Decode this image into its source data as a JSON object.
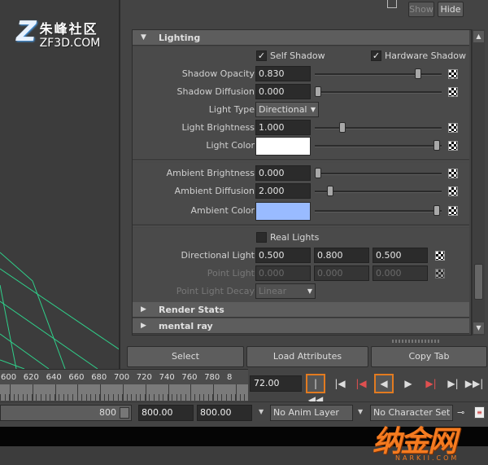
{
  "watermark_top": {
    "logo_letter": "Z",
    "chinese": "朱峰社区",
    "site": "ZF3D.COM"
  },
  "watermark_bottom": {
    "chinese": "纳金网",
    "site": "NARKII.COM"
  },
  "topbar": {
    "show_label": "Show",
    "hide_label": "Hide"
  },
  "sections": {
    "lighting": {
      "title": "Lighting",
      "self_shadow_label": "Self Shadow",
      "self_shadow_checked": true,
      "hardware_shadow_label": "Hardware Shadow",
      "hardware_shadow_checked": true,
      "shadow_opacity": {
        "label": "Shadow Opacity",
        "value": "0.830",
        "fraction": 0.83
      },
      "shadow_diffusion": {
        "label": "Shadow Diffusion",
        "value": "0.000",
        "fraction": 0.0
      },
      "light_type": {
        "label": "Light Type",
        "value": "Directional"
      },
      "light_brightness": {
        "label": "Light Brightness",
        "value": "1.000",
        "fraction": 0.2
      },
      "light_color": {
        "label": "Light Color",
        "color": "#ffffff"
      },
      "ambient_brightness": {
        "label": "Ambient Brightness",
        "value": "0.000",
        "fraction": 0.0
      },
      "ambient_diffusion": {
        "label": "Ambient Diffusion",
        "value": "2.000",
        "fraction": 0.1
      },
      "ambient_color": {
        "label": "Ambient Color",
        "color": "#99bbff"
      },
      "real_lights": {
        "label": "Real Lights",
        "checked": false
      },
      "directional_light": {
        "label": "Directional Light",
        "values": [
          "0.500",
          "0.800",
          "0.500"
        ]
      },
      "point_light": {
        "label": "Point Light",
        "values": [
          "0.000",
          "0.000",
          "0.000"
        ]
      },
      "point_light_decay": {
        "label": "Point Light Decay",
        "value": "Linear"
      }
    },
    "render_stats": {
      "title": "Render Stats"
    },
    "mental_ray": {
      "title": "mental ray"
    }
  },
  "buttons": {
    "select": "Select",
    "load_attributes": "Load Attributes",
    "copy_tab": "Copy Tab"
  },
  "timeline": {
    "ticks": [
      "600",
      "620",
      "640",
      "660",
      "680",
      "700",
      "720",
      "740",
      "760",
      "780",
      "8"
    ],
    "current_time": "72.00"
  },
  "rangebar": {
    "range_end": "800",
    "playback_end": "800.00",
    "animation_end": "800.00",
    "anim_layer": "No Anim Layer",
    "character_set": "No Character Set"
  },
  "colors": {
    "highlight": "#e27b20",
    "grid": "#27d98a"
  }
}
